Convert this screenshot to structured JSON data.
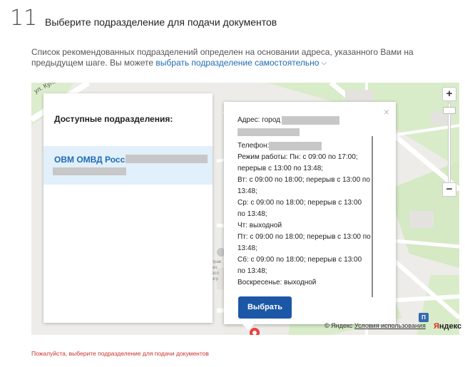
{
  "step": {
    "number": "11",
    "title": "Выберите подразделение для подачи документов"
  },
  "description": {
    "text": "Список рекомендованных подразделений определен на основании адреса, указанного Вами на предыдущем шаге. Вы можете ",
    "link": "выбрать подразделение самостоятельно"
  },
  "map": {
    "street_label": "ул. Культуры",
    "poi_label": "прав\nмо\nвол\nигр"
  },
  "list": {
    "header": "Доступные подразделения:",
    "items": [
      {
        "name": "ОВМ ОМВД России"
      }
    ]
  },
  "popup": {
    "address_label": "Адрес: город",
    "phone_label": "Телефон:",
    "schedule": [
      "Режим работы: Пн: с 09:00 по 17:00;",
      "перерыв с 13:00 по 13:48;",
      "Вт: с 09:00 по 18:00; перерыв с 13:00 по",
      "13:48;",
      "Ср: с 09:00 по 18:00; перерыв с 13:00",
      "по 13:48;",
      "Чт: выходной",
      "Пт: с 09:00 по 18:00; перерыв с 13:00 по",
      "13:48;",
      "Сб: с 09:00 по 18:00; перерыв с 13:00",
      "по 13:48;",
      "Воскресенье: выходной"
    ],
    "button": "Выбрать",
    "close": "×"
  },
  "zoom": {
    "plus": "+",
    "minus": "−"
  },
  "attribution": {
    "copyright": "© Яндекс",
    "terms": "Условия использования",
    "logo_red": "Я",
    "logo_rest": "ндекс"
  },
  "traffic_icon": "П",
  "error": "Пожалуйста, выберите подразделение для подачи документов",
  "colors": {
    "link": "#1f6ab5",
    "button": "#1b57a6",
    "error": "#c9302c",
    "selected_row": "#e1f0fa"
  }
}
